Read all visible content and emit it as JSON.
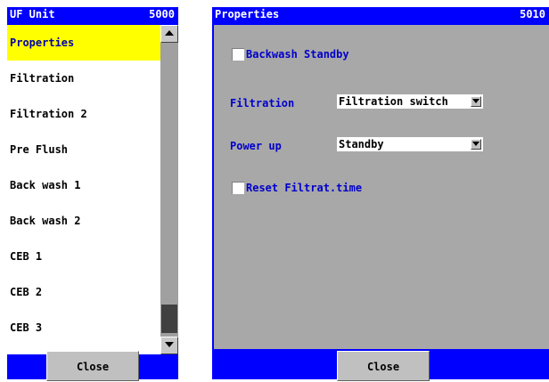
{
  "left_panel": {
    "title": "UF Unit",
    "number": "5000",
    "items": [
      {
        "label": "Properties",
        "selected": true
      },
      {
        "label": "Filtration"
      },
      {
        "label": "Filtration 2"
      },
      {
        "label": "Pre Flush"
      },
      {
        "label": "Back wash 1"
      },
      {
        "label": "Back wash 2"
      },
      {
        "label": "CEB 1"
      },
      {
        "label": "CEB 2"
      },
      {
        "label": "CEB 3"
      }
    ],
    "close_label": "Close",
    "scrollbar_icons": {
      "up": "triangle-up-icon",
      "down": "triangle-down-icon"
    }
  },
  "right_panel": {
    "title": "Properties",
    "number": "5010",
    "backwash_standby_label": "Backwash Standby",
    "filtration_label": "Filtration",
    "filtration_value": "Filtration switch",
    "power_up_label": "Power up",
    "power_up_value": "Standby",
    "reset_label": "Reset Filtrat.time",
    "close_label": "Close"
  },
  "colors": {
    "panel": "#0000ff",
    "selected": "#ffff00",
    "content_bg": "#a8a8a8",
    "label_text": "#0000cc"
  }
}
